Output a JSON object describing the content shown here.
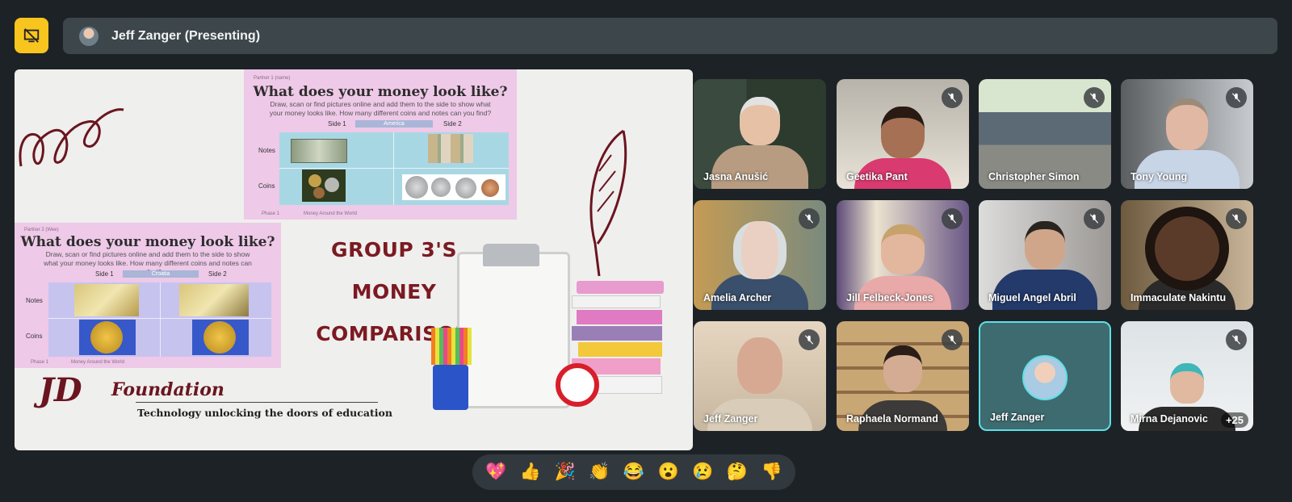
{
  "presenter_bar": {
    "name": "Jeff Zanger (Presenting)"
  },
  "slide": {
    "card1": {
      "caption": "Partner 1 (name)",
      "title": "What does your money look like?",
      "desc": "Draw, scan or find pictures online and add them to the side to show what your money looks like. How many different coins and notes can you find?",
      "side1": "Side 1",
      "country": "America",
      "side2": "Side 2",
      "notes": "Notes",
      "coins": "Coins",
      "footer_left": "Phase 1",
      "footer_right": "Money Around the World"
    },
    "card2": {
      "caption": "Partner 2 (Wee)",
      "title": "What does your money look like?",
      "desc": "Draw, scan or find pictures online and add them to the side to show what your money looks like. How many different coins and notes can you find?",
      "side1": "Side 1",
      "country": "Croatia",
      "side2": "Side 2",
      "notes": "Notes",
      "coins": "Coins",
      "footer_left": "Phase 1",
      "footer_right": "Money Around the World"
    },
    "group_title_line1": "GROUP 3'S MONEY",
    "group_title_line2": "COMPARISON",
    "logo_mark": "JD",
    "logo_name": "Foundation",
    "logo_tagline": "Technology unlocking the doors of education"
  },
  "participants": [
    {
      "name": "Jasna Anušić",
      "muted": false
    },
    {
      "name": "Geetika Pant",
      "muted": true
    },
    {
      "name": "Christopher Simon",
      "muted": true
    },
    {
      "name": "Tony Young",
      "muted": true
    },
    {
      "name": "Amelia Archer",
      "muted": true
    },
    {
      "name": "Jill Felbeck-Jones",
      "muted": true
    },
    {
      "name": "Miguel Angel Abril",
      "muted": true
    },
    {
      "name": "Immaculate Nakintu",
      "muted": true
    },
    {
      "name": "Jeff Zanger",
      "muted": true
    },
    {
      "name": "Raphaela Normand",
      "muted": true
    },
    {
      "name": "Jeff Zanger",
      "muted": false
    },
    {
      "name": "Mirna Dejanovic",
      "muted": true
    }
  ],
  "more_count": "+25",
  "reactions": [
    "💖",
    "👍",
    "🎉",
    "👏",
    "😂",
    "😮",
    "😢",
    "🤔",
    "👎"
  ],
  "colors": {
    "accent_yellow": "#f7c51e",
    "active_speaker": "#5de0e6",
    "slide_title": "#7b1a22"
  }
}
